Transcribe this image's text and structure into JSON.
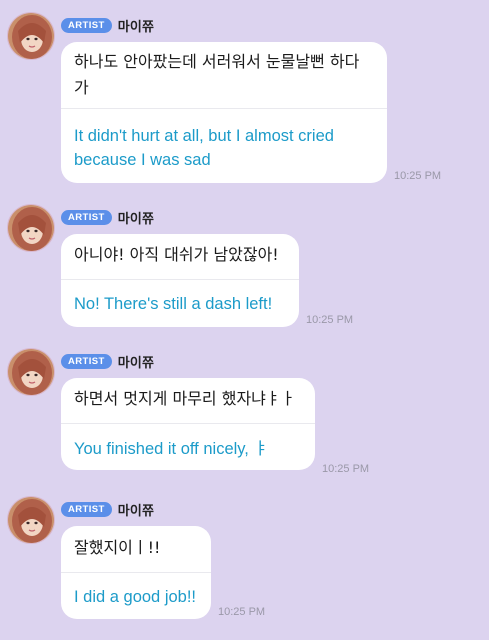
{
  "colors": {
    "background": "#dcd3ef",
    "bubble": "#ffffff",
    "badge": "#5b8fe9",
    "translation_text": "#1c9bc9",
    "timestamp": "#9a98a8"
  },
  "messages": [
    {
      "badge": "ARTIST",
      "sender": "마이쮸",
      "original": "하나도 안아팠는데 서러워서 눈물날뻔 하다\n가",
      "translation": "It didn't hurt at all, but I almost cried\nbecause I was sad",
      "time": "10:25 PM",
      "avatar_icon": "artist-avatar"
    },
    {
      "badge": "ARTIST",
      "sender": "마이쮸",
      "original": "아니야! 아직 대쉬가 남았잖아!",
      "translation": "No! There's still a dash left!",
      "time": "10:25 PM",
      "avatar_icon": "artist-avatar"
    },
    {
      "badge": "ARTIST",
      "sender": "마이쮸",
      "original": "하면서 멋지게 마무리 했자냐ㅑㅏ",
      "translation": "You finished it off nicely, ㅑ",
      "time": "10:25 PM",
      "avatar_icon": "artist-avatar"
    },
    {
      "badge": "ARTIST",
      "sender": "마이쮸",
      "original": "잘했지이ㅣ!!",
      "translation": "I did a good job!!",
      "time": "10:25 PM",
      "avatar_icon": "artist-avatar"
    }
  ]
}
